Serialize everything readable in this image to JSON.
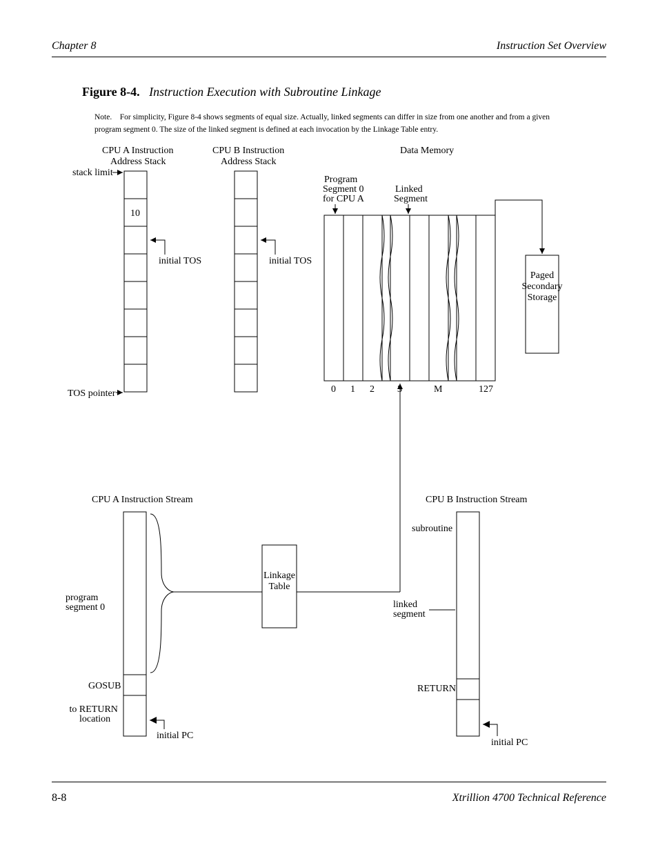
{
  "header": {
    "left": "Chapter 8",
    "right": "Instruction Set Overview"
  },
  "figure": {
    "number": "Figure 8-4.",
    "title": "Instruction Execution with Subroutine Linkage"
  },
  "cpuA": {
    "title": "CPU A Instruction\nAddress Stack",
    "initial_label": "initial TOS",
    "row_content": "10",
    "stack_top_label": "stack limit",
    "stack_bottom_label": "TOS pointer"
  },
  "cpuB": {
    "title": "CPU B Instruction\nAddress Stack",
    "initial_label": "initial TOS"
  },
  "dataMemory": {
    "title": "Data Memory",
    "program_seg_label": "Program\nSegment 0\nfor CPU A",
    "linked_label": "Linked\nSegment",
    "seg3": "3",
    "segM": "M",
    "seg127": "127",
    "storage_label": "Paged\nSecondary\nStorage"
  },
  "instruction_stream": {
    "title_a": "CPU A Instruction Stream",
    "title_b": "CPU B Instruction Stream",
    "gosub_label": "GOSUB",
    "return_label": " to RETURN\nlocation",
    "prog_seg_center": "program segment 0",
    "initial_pc_a": "initial PC",
    "sub_label": "subroutine",
    "linked_seg_label": "linked segment",
    "return_inst": "RETURN",
    "initial_pc_b": "initial PC"
  },
  "linkage": {
    "title": "Linkage\nTable"
  },
  "footnote_text": "Note. For simplicity, Figure 8-4 shows segments of equal size. Actually, linked segments can differ in size from one another and from a given program segment 0. The size of the linked segment is defined at each invocation by the Linkage Table entry.",
  "footer": {
    "left": "8-8",
    "right": "Xtrillion 4700 Technical Reference"
  }
}
